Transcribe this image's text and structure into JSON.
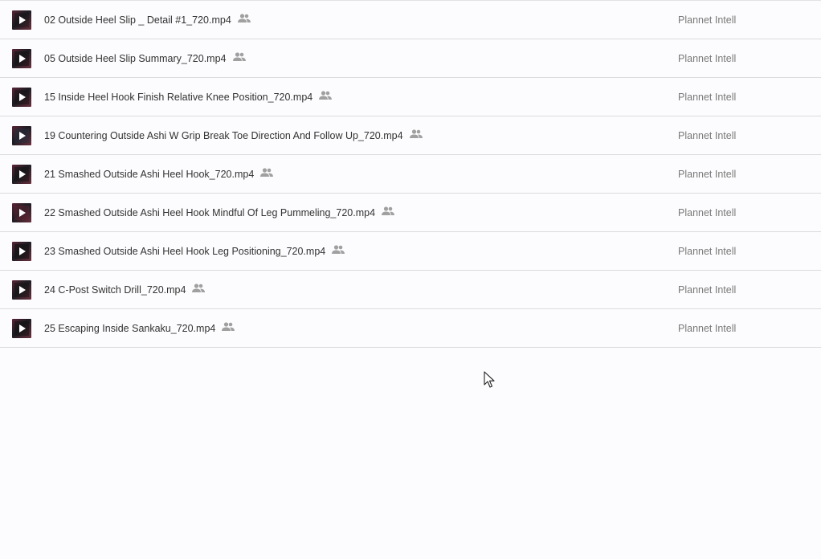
{
  "files": [
    {
      "name": "02 Outside Heel Slip _ Detail #1_720.mp4",
      "owner": "Plannet Intell",
      "icon": "people-icon"
    },
    {
      "name": "05 Outside Heel Slip Summary_720.mp4",
      "owner": "Plannet Intell",
      "icon": "people-icon"
    },
    {
      "name": "15 Inside Heel Hook Finish Relative Knee Position_720.mp4",
      "owner": "Plannet Intell",
      "icon": "people-icon"
    },
    {
      "name": "19 Countering Outside Ashi W Grip Break Toe Direction And Follow Up_720.mp4",
      "owner": "Plannet Intell",
      "icon": "people-icon"
    },
    {
      "name": "21 Smashed Outside Ashi Heel Hook_720.mp4",
      "owner": "Plannet Intell",
      "icon": "people-icon"
    },
    {
      "name": "22 Smashed Outside Ashi Heel Hook Mindful Of Leg Pummeling_720.mp4",
      "owner": "Plannet Intell",
      "icon": "people-icon"
    },
    {
      "name": "23 Smashed Outside Ashi Heel Hook Leg Positioning_720.mp4",
      "owner": "Plannet Intell",
      "icon": "people-icon"
    },
    {
      "name": "24 C-Post Switch Drill_720.mp4",
      "owner": "Plannet Intell",
      "icon": "people-icon"
    },
    {
      "name": "25 Escaping Inside Sankaku_720.mp4",
      "owner": "Plannet Intell",
      "icon": "people-icon"
    }
  ],
  "colors": {
    "background": "#fcfbfd",
    "divider": "#dcdcdc",
    "text": "#333333",
    "owner_text": "#7a7a7a",
    "icon": "#a0a0a0"
  }
}
